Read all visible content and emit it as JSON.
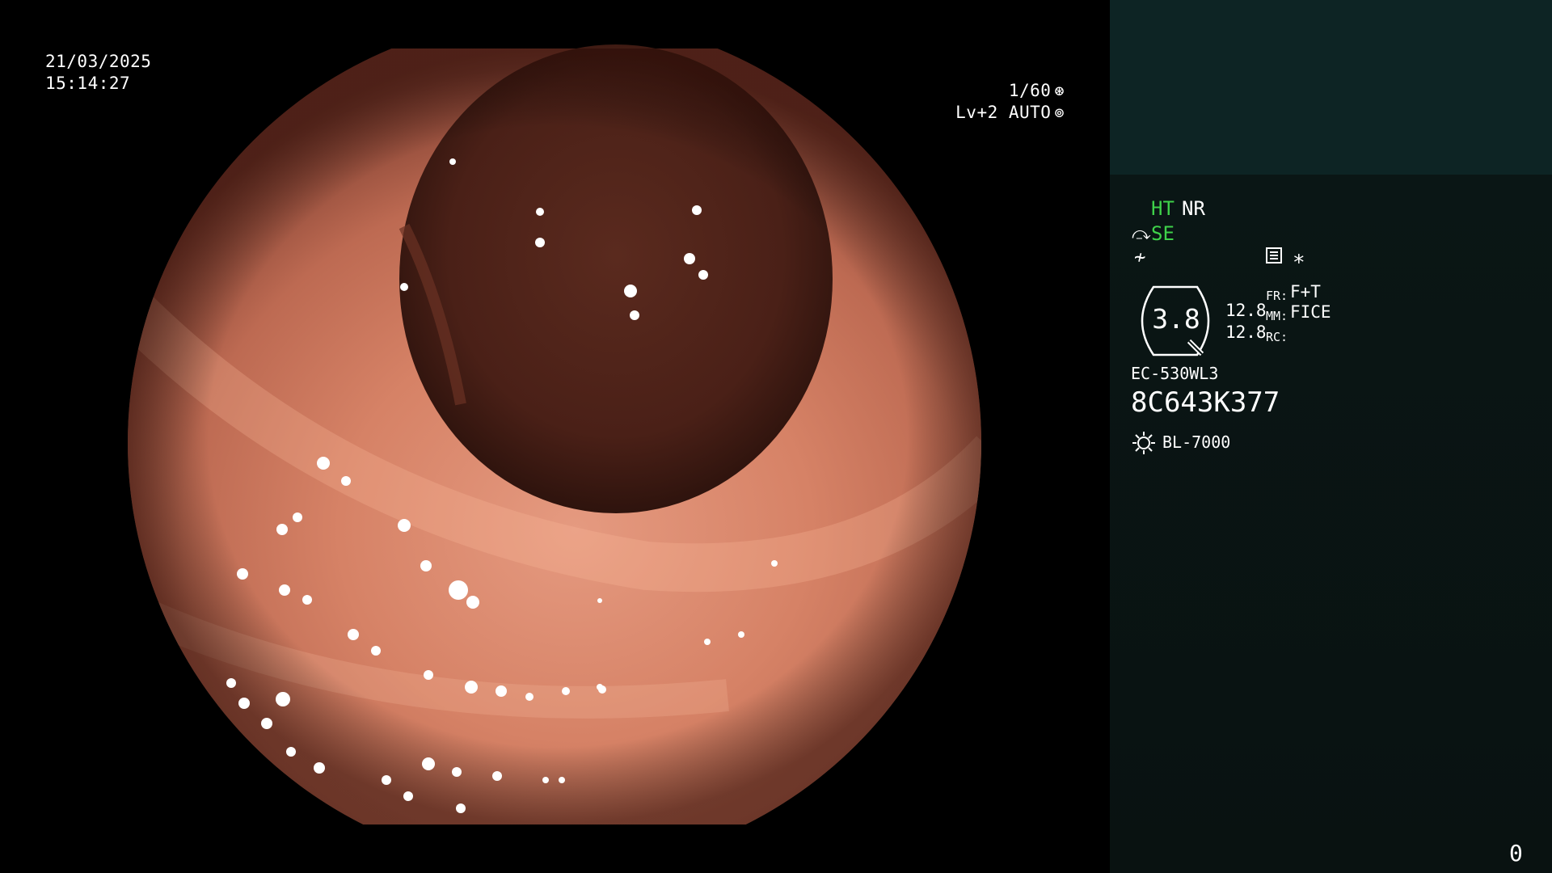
{
  "video": {
    "date": "21/03/2025",
    "time": "15:14:27",
    "shutter": "1/60",
    "shutter_icon": "shutter-icon",
    "iris": "Lv+2 AUTO",
    "iris_icon": "iris-icon"
  },
  "panel": {
    "ht_label": "HT",
    "nr_label": "NR",
    "se_label": "SE",
    "se_icon": "structure-enhance-icon",
    "f_icon": "freeze-icon",
    "menu_icon": "menu-icon",
    "star_icon": "star-icon",
    "zoom_value": "3.8",
    "value_1": "12.8",
    "value_2": "12.8",
    "fr_label": "FR:",
    "fr_value": "F+T",
    "mm_label": "MM:",
    "mm_value": "FICE",
    "rc_label": "RC:",
    "scope_model": "EC-530WL3",
    "scope_serial": "8C643K377",
    "lamp_icon": "lamp-icon",
    "light_source": "BL-7000",
    "counter": "0"
  },
  "colors": {
    "panel_bg": "#091211",
    "thumbnail_bg": "#0d2424",
    "active_green": "#3fd24a",
    "text": "#ffffff"
  }
}
